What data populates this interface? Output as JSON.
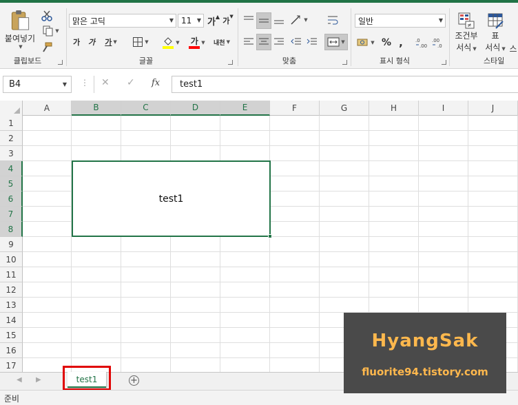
{
  "ribbon": {
    "clipboard": {
      "paste_label": "붙여넣기",
      "group_label": "클립보드"
    },
    "font": {
      "font_name": "맑은 고딕",
      "font_size": "11",
      "grow_label": "가",
      "shrink_label": "가",
      "bold_label": "가",
      "italic_label": "가",
      "underline_label": "가",
      "font_color_label": "가",
      "phonetic_label": "내천",
      "group_label": "글꼴",
      "highlight_color": "#ffff00",
      "font_color": "#ff0000"
    },
    "alignment": {
      "group_label": "맞춤"
    },
    "number": {
      "format": "일반",
      "percent_label": "%",
      "comma_label": ",",
      "group_label": "표시 형식"
    },
    "styles": {
      "conditional_label_1": "조건부",
      "conditional_label_2": "서식",
      "table_label_1": "표",
      "table_label_2": "서식",
      "cell_styles_label": "스",
      "group_label": "스타일"
    }
  },
  "formula_bar": {
    "name_box": "B4",
    "fx_label": "fx",
    "content": "test1"
  },
  "grid": {
    "columns": [
      "A",
      "B",
      "C",
      "D",
      "E",
      "F",
      "G",
      "H",
      "I",
      "J"
    ],
    "rows": [
      "1",
      "2",
      "3",
      "4",
      "5",
      "6",
      "7",
      "8",
      "9",
      "10",
      "11",
      "12",
      "13",
      "14",
      "15",
      "16",
      "17"
    ],
    "merged_cell_value": "test1"
  },
  "sheets": {
    "active_tab": "test1"
  },
  "status": {
    "text": "준비"
  },
  "watermark": {
    "title": "HyangSak",
    "url": "fluorite94.tistory.com"
  },
  "colors": {
    "accent": "#217346",
    "highlight_box": "#e00000",
    "watermark_text": "#ffb84d"
  }
}
